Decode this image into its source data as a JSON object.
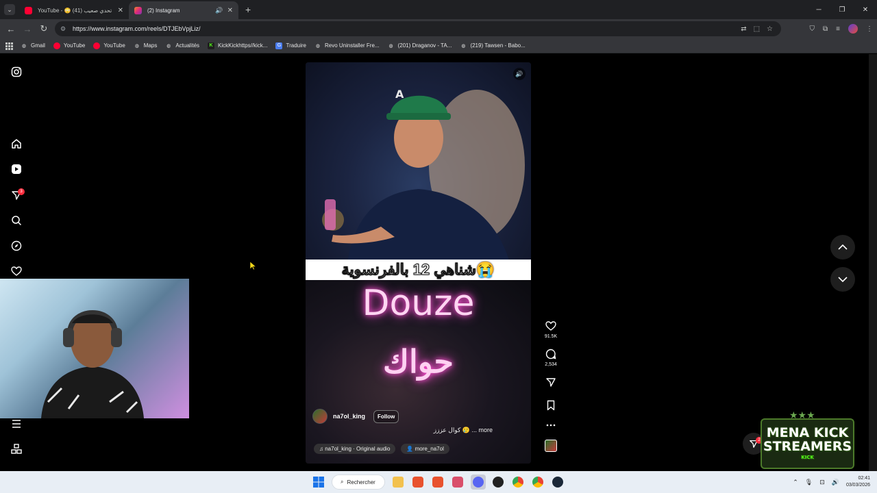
{
  "browser": {
    "tabs": [
      {
        "title": "YouTube - 😳 تحدي صعيب (41)",
        "active": false
      },
      {
        "title": "(2) Instagram",
        "active": true
      }
    ],
    "url": "https://www.instagram.com/reels/DTJEbVpjLiz/",
    "bookmarks": [
      "Gmail",
      "YouTube",
      "YouTube",
      "Maps",
      "Actualités",
      "KickKickhttps//kick...",
      "Traduire",
      "Revo Uninstaller Fre...",
      "(201) Draganov - TA...",
      "(219) Tawsen - Babo..."
    ]
  },
  "sidebar": {
    "notification_badge": "3",
    "icons": [
      "instagram-icon",
      "home-icon",
      "reels-icon",
      "messages-icon",
      "search-icon",
      "explore-icon",
      "heart-icon",
      "menu-icon",
      "apps-icon"
    ]
  },
  "reel": {
    "caption_overlay": "شناهي 12 بالفرنسوية😭",
    "neon_title": "Douze",
    "neon_arabic": "حواك",
    "username": "na7ol_king",
    "follow_label": "Follow",
    "description": "كوال عززز 🥲 ... more",
    "audio": "na7ol_king · Original audio",
    "tagged": "more_na7ol"
  },
  "actions": {
    "likes": "91.5K",
    "comments": "2,534"
  },
  "messages_badge": "2",
  "watermark": {
    "line1": "MENA KICK",
    "line2": "STREAMERS",
    "tag": "KICK"
  },
  "taskbar": {
    "search_label": "Rechercher",
    "time": "02:41",
    "date": "03/03/2026"
  },
  "colors": {
    "accent_pink": "#ff4fd3",
    "badge_red": "#ff3040"
  }
}
